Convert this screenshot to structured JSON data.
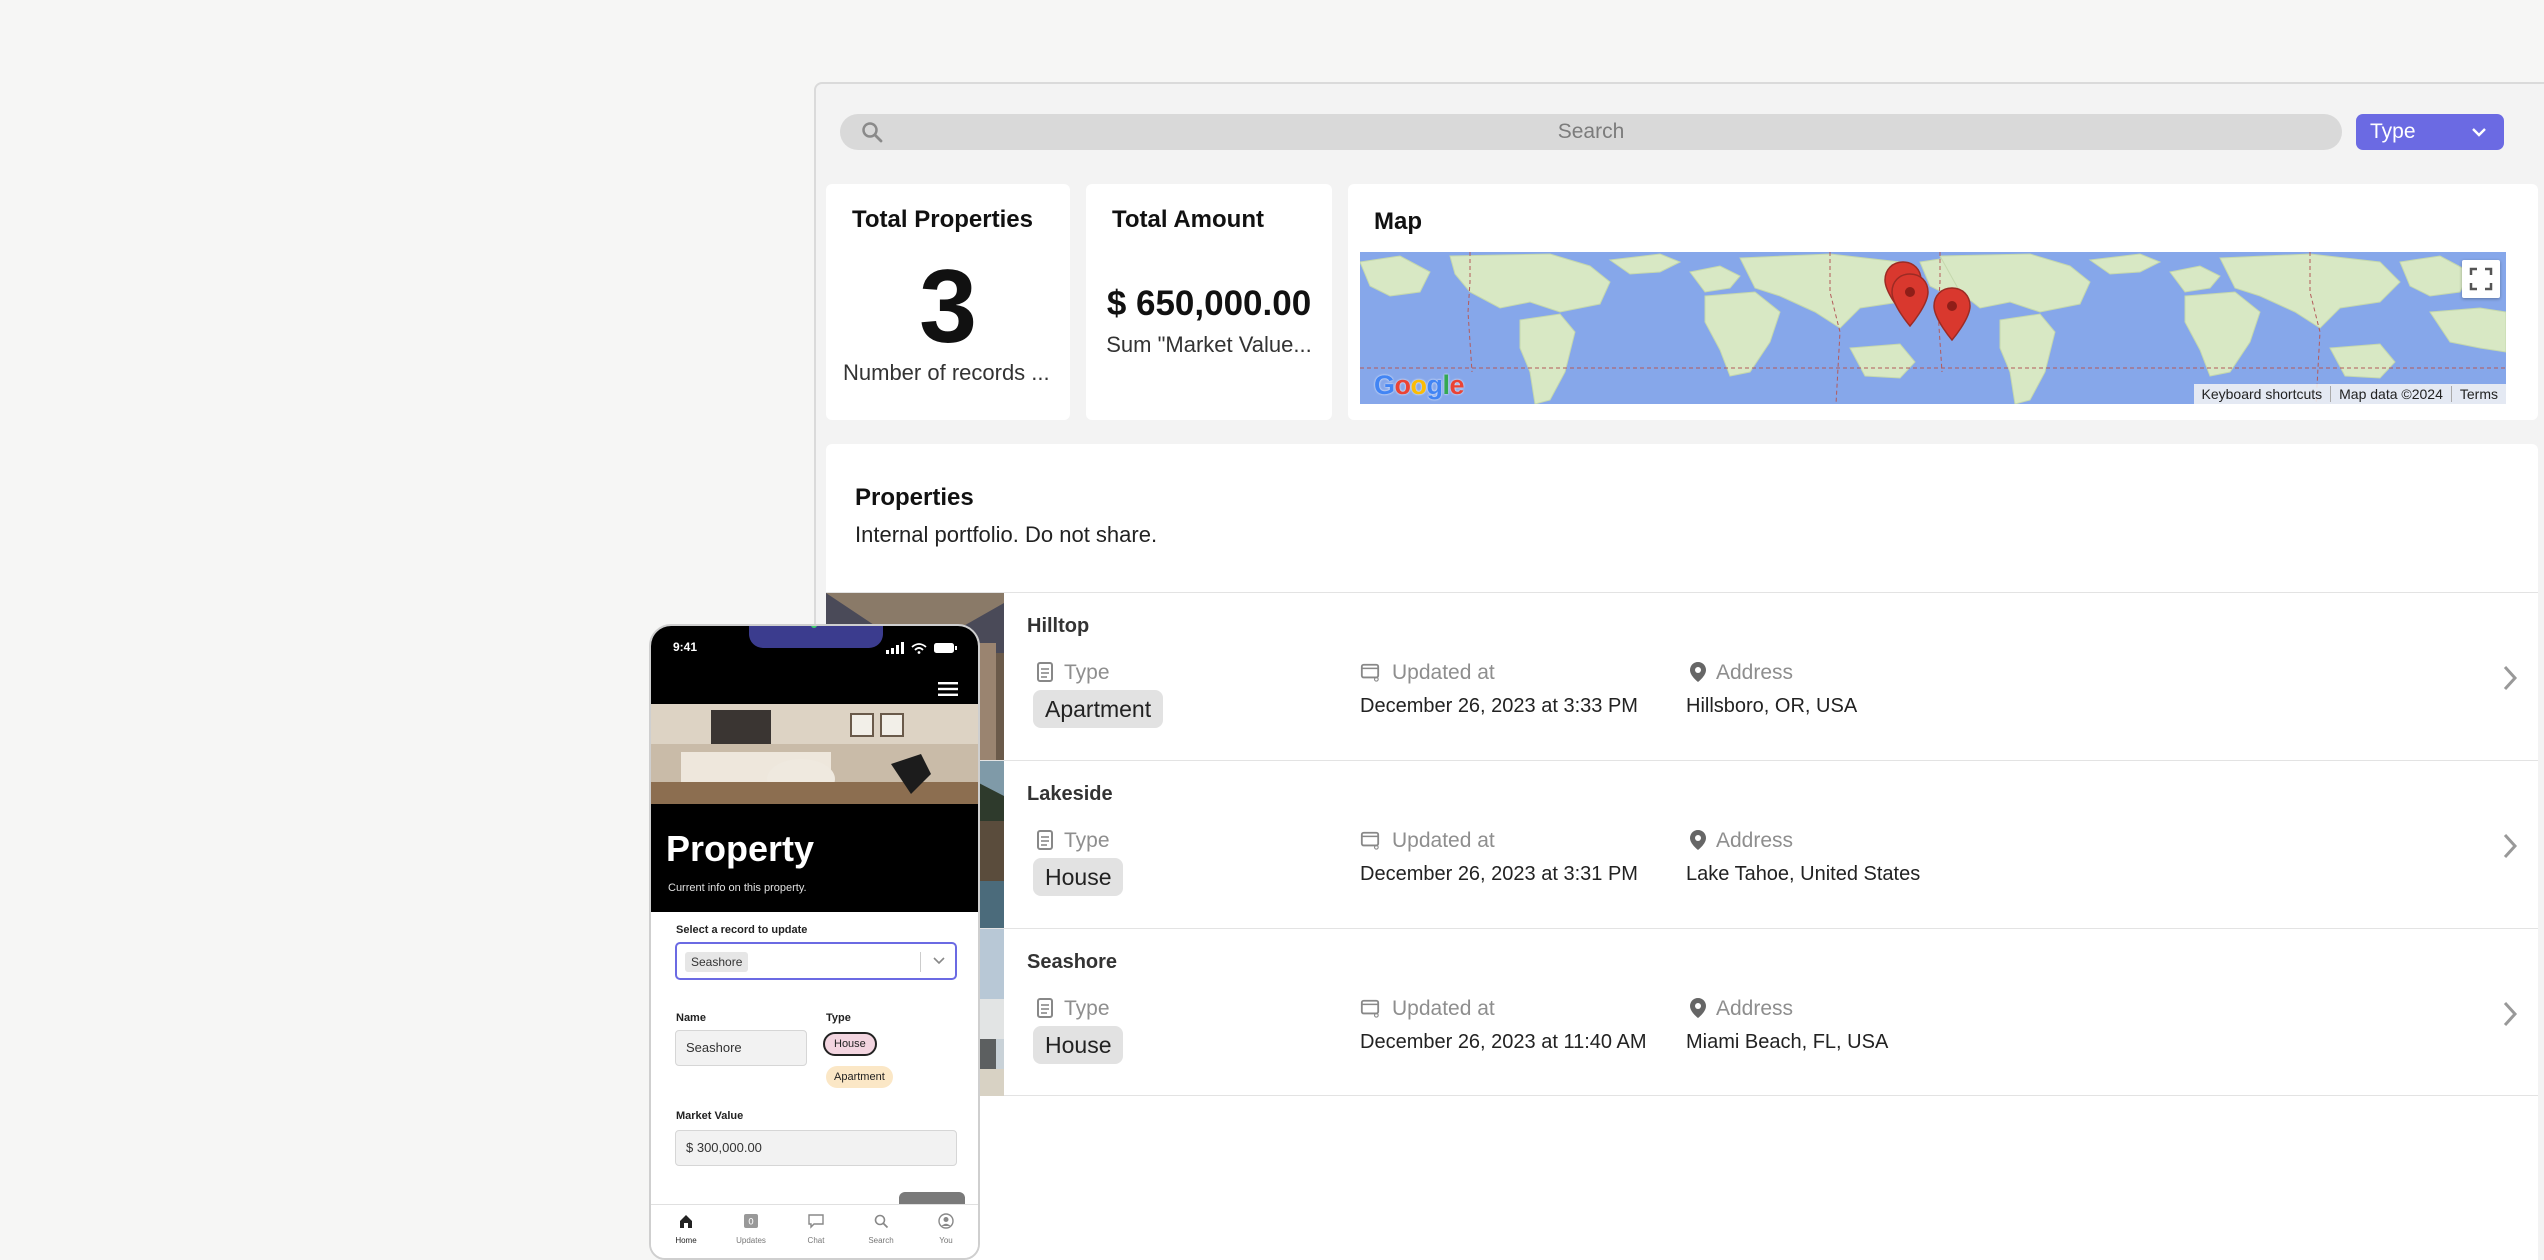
{
  "search": {
    "placeholder": "Search"
  },
  "type_filter": {
    "label": "Type"
  },
  "kpis": {
    "total_properties": {
      "title": "Total Properties",
      "value": "3",
      "caption": "Number of records ..."
    },
    "total_amount": {
      "title": "Total Amount",
      "value": "$ 650,000.00",
      "caption": "Sum \"Market Value..."
    }
  },
  "map": {
    "title": "Map",
    "logo": [
      "G",
      "o",
      "o",
      "g",
      "l",
      "e"
    ],
    "attribution": [
      "Keyboard shortcuts",
      "Map data ©2024",
      "Terms"
    ]
  },
  "properties": {
    "title": "Properties",
    "subtitle": "Internal portfolio. Do not share.",
    "field_labels": {
      "type": "Type",
      "updated": "Updated at",
      "address": "Address"
    },
    "rows": [
      {
        "name": "Hilltop",
        "type": "Apartment",
        "updated": "December 26, 2023 at 3:33 PM",
        "address": "Hillsboro, OR, USA"
      },
      {
        "name": "Lakeside",
        "type": "House",
        "updated": "December 26, 2023 at 3:31 PM",
        "address": "Lake Tahoe, United States"
      },
      {
        "name": "Seashore",
        "type": "House",
        "updated": "December 26, 2023 at 11:40 AM",
        "address": "Miami Beach, FL, USA"
      }
    ]
  },
  "phone": {
    "time": "9:41",
    "title": "Property",
    "subtitle": "Current info on this property.",
    "select_label": "Select a record to update",
    "selected_record": "Seashore",
    "name_label": "Name",
    "name_value": "Seashore",
    "type_label": "Type",
    "type_options": [
      "House",
      "Apartment"
    ],
    "market_value_label": "Market Value",
    "market_value": "$ 300,000.00",
    "updates_badge": "0",
    "tabs": [
      "Home",
      "Updates",
      "Chat",
      "Search",
      "You"
    ]
  },
  "colors": {
    "accent": "#6b6ae3",
    "map_water": "#86a7ea",
    "map_land": "#d8e8c4",
    "marker": "#d9382e"
  }
}
